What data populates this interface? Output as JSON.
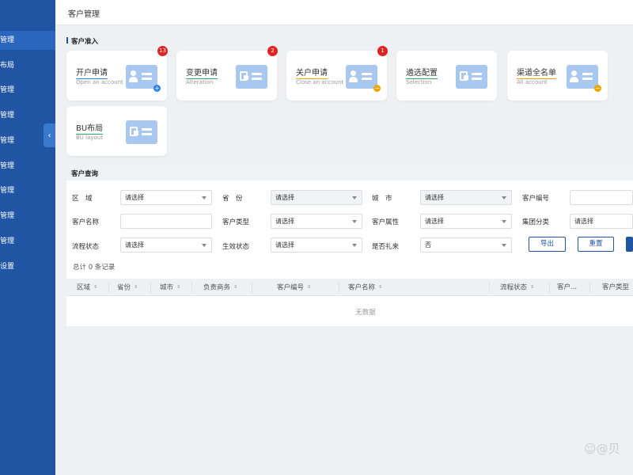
{
  "sidebar": {
    "items": [
      {
        "label": "管理",
        "active": true
      },
      {
        "label": "布局"
      },
      {
        "label": "管理"
      },
      {
        "label": "管理"
      },
      {
        "label": "管理"
      },
      {
        "label": "管理"
      },
      {
        "label": "管理"
      },
      {
        "label": "管理"
      },
      {
        "label": "管理"
      },
      {
        "label": "设置"
      }
    ],
    "collapse_icon": "‹"
  },
  "header": {
    "title": "客户管理"
  },
  "access": {
    "title": "客户准入",
    "cards": [
      {
        "title": "开户申请",
        "subtitle": "Open an account",
        "badge": "13",
        "icon": "user-card-icon",
        "mini": "+",
        "mini_color": "#2f80ed"
      },
      {
        "title": "变更申请",
        "subtitle": "Alteration",
        "badge": "2",
        "icon": "change-card-icon"
      },
      {
        "title": "关户申请",
        "subtitle": "Close an account",
        "badge": "1",
        "icon": "user-card-icon",
        "mini": "−",
        "mini_color": "#f0a500"
      },
      {
        "title": "遴选配置",
        "subtitle": "Selection",
        "icon": "change-card-icon"
      },
      {
        "title": "渠道全名单",
        "subtitle": "All account",
        "icon": "user-card-icon",
        "mini": "−",
        "mini_color": "#f0a500"
      },
      {
        "title": "BU布局",
        "subtitle": "BU layout",
        "icon": "change-card-icon"
      }
    ]
  },
  "query": {
    "title": "客户查询",
    "fields": {
      "region": {
        "label": "区　域",
        "value": "请选择"
      },
      "province": {
        "label": "省　份",
        "value": "请选择"
      },
      "city": {
        "label": "城　市",
        "value": "请选择"
      },
      "customer_no": {
        "label": "客户编号",
        "value": ""
      },
      "customer_name": {
        "label": "客户名称",
        "value": ""
      },
      "customer_type": {
        "label": "客户类型",
        "value": "请选择"
      },
      "customer_attr": {
        "label": "客户属性",
        "value": "请选择"
      },
      "group_class": {
        "label": "集团分类",
        "value": "请选择"
      },
      "flow_status": {
        "label": "流程状态",
        "value": "请选择"
      },
      "effective_status": {
        "label": "生效状态",
        "value": "请选择"
      },
      "gift": {
        "label": "是否礼来",
        "value": "否"
      }
    },
    "buttons": {
      "export": "导出",
      "reset": "重置"
    }
  },
  "table": {
    "total": "总计 0 条记录",
    "columns": [
      "区域",
      "省份",
      "城市",
      "负责商务",
      "客户编号",
      "客户名称",
      "流程状态",
      "客户...",
      "客户类型"
    ],
    "empty": "无数据"
  },
  "watermark": "☺@贝"
}
